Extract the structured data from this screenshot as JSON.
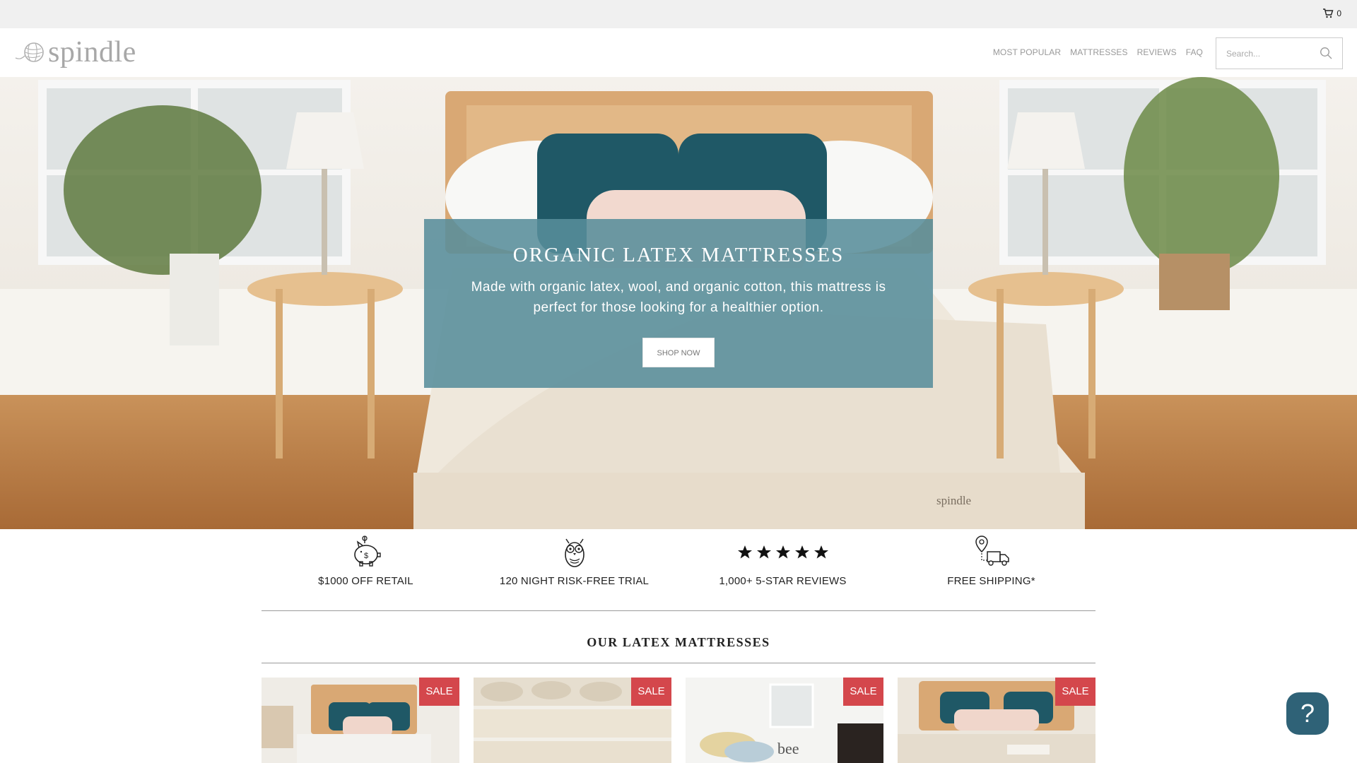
{
  "topbar": {
    "cart_count": "0"
  },
  "header": {
    "logo_text": "spindle"
  },
  "nav": {
    "items": [
      {
        "label": "MOST POPULAR"
      },
      {
        "label": "MATTRESSES"
      },
      {
        "label": "REVIEWS"
      },
      {
        "label": "FAQ"
      }
    ]
  },
  "search": {
    "placeholder": "Search..."
  },
  "hero": {
    "title": "ORGANIC LATEX MATTRESSES",
    "subtitle": "Made with organic latex, wool, and organic cotton, this mattress is perfect for those looking for a healthier option.",
    "button_label": "SHOP NOW",
    "headboard_brand": "spindle"
  },
  "features": [
    {
      "label": "$1000 OFF RETAIL",
      "icon": "piggy-bank-icon"
    },
    {
      "label": "120 NIGHT RISK-FREE TRIAL",
      "icon": "owl-icon"
    },
    {
      "label": "1,000+ 5-STAR REVIEWS",
      "icon": "five-stars-icon"
    },
    {
      "label": "FREE SHIPPING*",
      "icon": "delivery-truck-icon"
    }
  ],
  "section": {
    "title": "OUR LATEX MATTRESSES"
  },
  "products": [
    {
      "badge": "SALE"
    },
    {
      "badge": "SALE"
    },
    {
      "badge": "SALE"
    },
    {
      "badge": "SALE"
    }
  ],
  "help": {
    "label": "?"
  },
  "colors": {
    "accent": "#588d9b",
    "sale": "#d4474c",
    "help": "#2f6277"
  }
}
